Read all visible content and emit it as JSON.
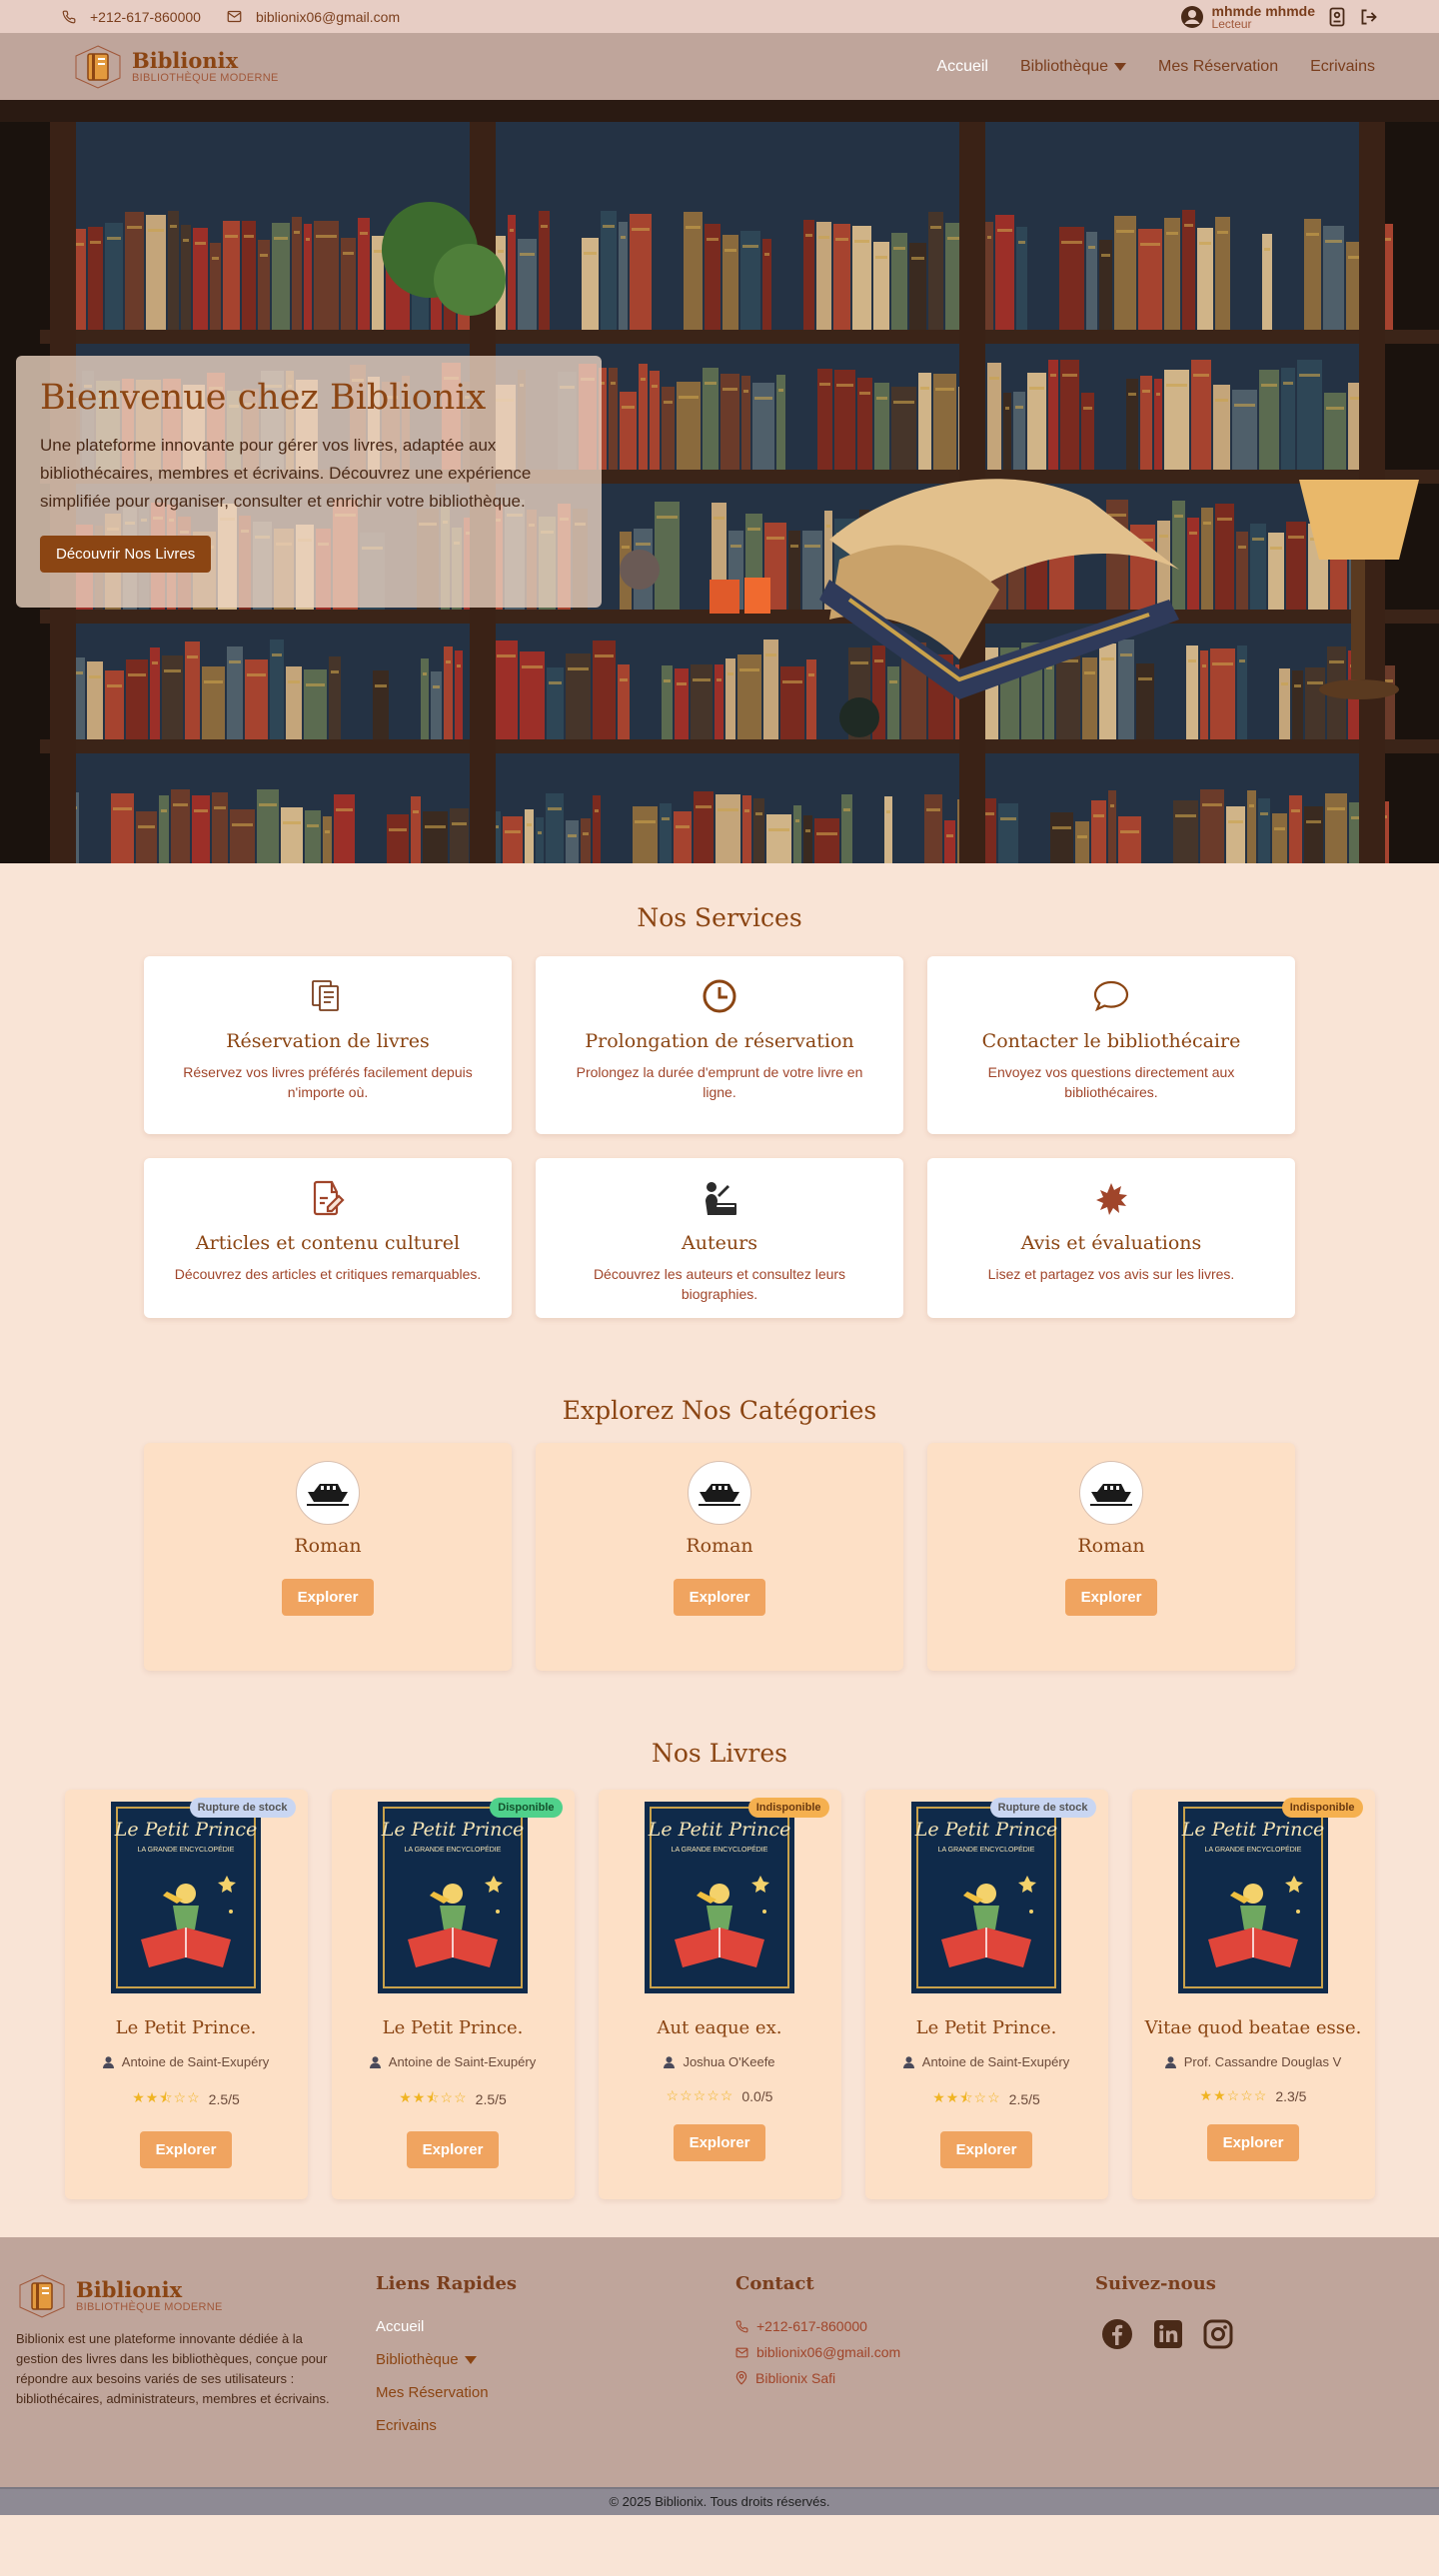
{
  "topbar": {
    "phone": "+212-617-860000",
    "email": "biblionix06@gmail.com",
    "user_name": "mhmde mhmde",
    "user_role": "Lecteur"
  },
  "brand": {
    "name": "Biblionix",
    "tagline": "BIBLIOTHÈQUE MODERNE"
  },
  "nav": {
    "home": "Accueil",
    "library": "Bibliothèque",
    "reservations": "Mes Réservation",
    "writers": "Ecrivains"
  },
  "hero": {
    "title": "Bienvenue chez Biblionix",
    "text": "Une plateforme innovante pour gérer vos livres, adaptée aux bibliothécaires, membres et écrivains. Découvrez une expérience simplifiée pour organiser, consulter et enrichir votre bibliothèque.",
    "cta": "Découvrir Nos Livres"
  },
  "services": {
    "title": "Nos Services",
    "items": [
      {
        "icon": "copy-icon",
        "title": "Réservation de livres",
        "desc": "Réservez vos livres préférés facilement depuis n'importe où."
      },
      {
        "icon": "clock-icon",
        "title": "Prolongation de réservation",
        "desc": "Prolongez la durée d'emprunt de votre livre en ligne."
      },
      {
        "icon": "chat-icon",
        "title": "Contacter le bibliothécaire",
        "desc": "Envoyez vos questions directement aux bibliothécaires."
      },
      {
        "icon": "edit-document-icon",
        "title": "Articles et contenu culturel",
        "desc": "Découvrez des articles et critiques remarquables."
      },
      {
        "icon": "author-icon",
        "title": "Auteurs",
        "desc": "Découvrez les auteurs et consultez leurs biographies."
      },
      {
        "icon": "splat-icon",
        "title": "Avis et évaluations",
        "desc": "Lisez et partagez vos avis sur les livres."
      }
    ]
  },
  "categories": {
    "title": "Explorez Nos Catégories",
    "button": "Explorer",
    "items": [
      {
        "name": "Roman"
      },
      {
        "name": "Roman"
      },
      {
        "name": "Roman"
      }
    ]
  },
  "books": {
    "title": "Nos Livres",
    "button": "Explorer",
    "cover_title": "Le Petit Prince",
    "cover_subtitle": "LA GRANDE ENCYCLOPÉDIE",
    "items": [
      {
        "title": "Le Petit Prince.",
        "author": "Antoine de Saint-Exupéry",
        "rating": "2.5/5",
        "stars": 2.5,
        "status": "Rupture de stock",
        "status_type": "rupture"
      },
      {
        "title": "Le Petit Prince.",
        "author": "Antoine de Saint-Exupéry",
        "rating": "2.5/5",
        "stars": 2.5,
        "status": "Disponible",
        "status_type": "dispo"
      },
      {
        "title": "Aut eaque ex.",
        "author": "Joshua O'Keefe",
        "rating": "0.0/5",
        "stars": 0,
        "status": "Indisponible",
        "status_type": "indispo"
      },
      {
        "title": "Le Petit Prince.",
        "author": "Antoine de Saint-Exupéry",
        "rating": "2.5/5",
        "stars": 2.5,
        "status": "Rupture de stock",
        "status_type": "rupture"
      },
      {
        "title": "Vitae quod beatae esse.",
        "author": "Prof. Cassandre Douglas V",
        "rating": "2.3/5",
        "stars": 2.3,
        "status": "Indisponible",
        "status_type": "indispo"
      }
    ]
  },
  "footer": {
    "about": "Biblionix est une plateforme innovante dédiée à la gestion des livres dans les bibliothèques, conçue pour répondre aux besoins variés de ses utilisateurs : bibliothécaires, administrateurs, membres et écrivains.",
    "links_title": "Liens Rapides",
    "contact_title": "Contact",
    "contact_phone": "+212-617-860000",
    "contact_email": "biblionix06@gmail.com",
    "contact_address": "Biblionix Safi",
    "follow_title": "Suivez-nous",
    "copyright": "© 2025 Biblionix. Tous droits réservés."
  },
  "colors": {
    "accent": "#8b4513",
    "button_orange": "#f0a460",
    "page_bg": "#f9e4d6",
    "nav_bg": "#bfa59b"
  }
}
